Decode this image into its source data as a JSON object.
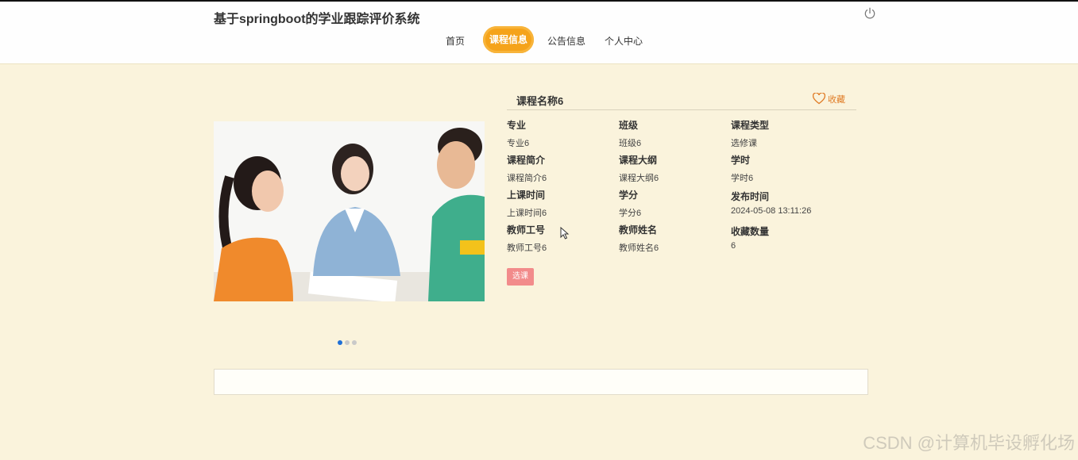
{
  "site": {
    "title": "基于springboot的学业跟踪评价系统"
  },
  "nav": {
    "items": [
      {
        "label": "首页",
        "active": false
      },
      {
        "label": "课程信息",
        "active": true
      },
      {
        "label": "公告信息",
        "active": false
      },
      {
        "label": "个人中心",
        "active": false
      }
    ]
  },
  "course": {
    "name": "课程名称6",
    "favorite_label": "收藏",
    "fields": [
      {
        "label": "专业",
        "value": "专业6"
      },
      {
        "label": "班级",
        "value": "班级6"
      },
      {
        "label": "课程类型",
        "value": "选修课"
      },
      {
        "label": "课程简介",
        "value": "课程简介6"
      },
      {
        "label": "课程大纲",
        "value": "课程大纲6"
      },
      {
        "label": "学时",
        "value": "学时6"
      },
      {
        "label": "上课时间",
        "value": "上课时间6"
      },
      {
        "label": "学分",
        "value": "学分6"
      },
      {
        "label": "发布时间",
        "value": "2024-05-08 13:11:26"
      },
      {
        "label": "教师工号",
        "value": "教师工号6"
      },
      {
        "label": "教师姓名",
        "value": "教师姓名6"
      },
      {
        "label": "收藏数量",
        "value": "6"
      }
    ],
    "enroll_label": "选课"
  },
  "slider": {
    "slides": 3,
    "active_index": 0
  },
  "watermark": "CSDN @计算机毕设孵化场",
  "colors": {
    "background": "#faf3dc",
    "nav_active": "#f5a31a",
    "favorite": "#e07b25",
    "enroll_button": "#f28b8b",
    "dot_active": "#1f6fd6"
  }
}
